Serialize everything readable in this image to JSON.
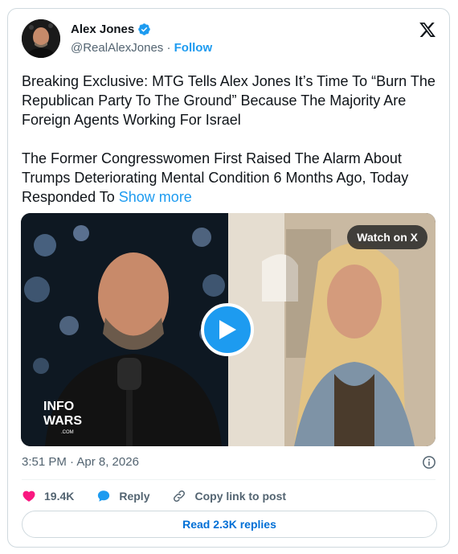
{
  "author": {
    "name": "Alex Jones",
    "handle": "@RealAlexJones",
    "separator": "·",
    "follow_label": "Follow",
    "verified": true
  },
  "tweet": {
    "paragraph1": "Breaking Exclusive: MTG Tells Alex Jones It’s Time To “Burn The Republican Party To The Ground” Because The Majority Are Foreign Agents Working For Israel",
    "paragraph2": "The Former Congresswomen First Raised The Alarm About Trumps Deteriorating Mental Condition 6 Months Ago, Today Responded To",
    "show_more": "Show more"
  },
  "media": {
    "watch_label": "Watch on X",
    "watermark": "INFO WARS .COM"
  },
  "timestamp": "3:51 PM · Apr 8, 2026",
  "actions": {
    "likes": "19.4K",
    "reply_label": "Reply",
    "copy_label": "Copy link to post"
  },
  "read_replies": "Read 2.3K replies",
  "colors": {
    "accent": "#1d9bf0",
    "like": "#f91880",
    "link": "#006fd6",
    "muted": "#536471"
  }
}
